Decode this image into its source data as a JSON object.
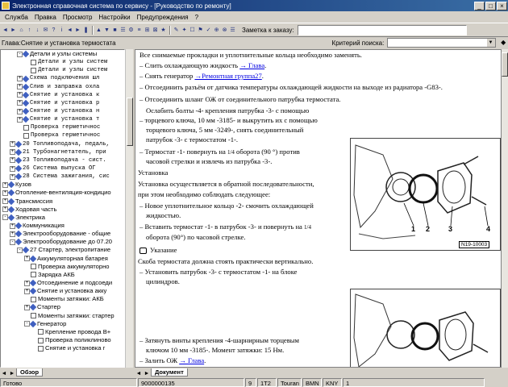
{
  "window": {
    "title": "Электронная справочная система по сервису - [Руководство по ремонту]",
    "min": "_",
    "max": "□",
    "close": "×"
  },
  "menu": [
    "Служба",
    "Правка",
    "Просмотр",
    "Настройки",
    "Предупреждения",
    "?"
  ],
  "toolbar": {
    "buttons": [
      "◄",
      "►",
      "⌂",
      "↑",
      "↓",
      "✉",
      "?",
      "i",
      "◄",
      "►",
      "❚",
      "▲",
      "▼",
      "■",
      "☰",
      "⚙",
      "≡",
      "⊞",
      "⊠",
      "★",
      "✎",
      "✦",
      "☐",
      "⚑",
      "✓",
      "⊕",
      "⊗",
      "☰"
    ],
    "note_label": "Заметка к заказу:"
  },
  "address": {
    "chapter_label": "Глава:Снятие и установка термостата",
    "search_label": "Критерий поиска:",
    "search_dropdown": "▼",
    "search_button": "◆"
  },
  "tree": [
    {
      "indent": 2,
      "pm": "-",
      "icon": "book",
      "text": "Детали и узлы системы",
      "mono": false
    },
    {
      "indent": 3,
      "pm": "",
      "icon": "page",
      "text": "Детали и узлы систем",
      "mono": true
    },
    {
      "indent": 3,
      "pm": "",
      "icon": "page",
      "text": "Детали и узлы систем",
      "mono": true
    },
    {
      "indent": 2,
      "pm": "+",
      "icon": "book",
      "text": "Схема подключения шл",
      "mono": true
    },
    {
      "indent": 2,
      "pm": "+",
      "icon": "book",
      "text": "Слив и заправка охла",
      "mono": true
    },
    {
      "indent": 2,
      "pm": "+",
      "icon": "book",
      "text": "Снятие и установка к",
      "mono": true
    },
    {
      "indent": 2,
      "pm": "+",
      "icon": "book",
      "text": "Снятие и установка р",
      "mono": true
    },
    {
      "indent": 2,
      "pm": "+",
      "icon": "book",
      "text": "Снятие и установка н",
      "mono": true
    },
    {
      "indent": 2,
      "pm": "+",
      "icon": "book",
      "text": "Снятие и установка т",
      "mono": true
    },
    {
      "indent": 2,
      "pm": "",
      "icon": "page",
      "text": "Проверка герметичнос",
      "mono": true
    },
    {
      "indent": 2,
      "pm": "",
      "icon": "page",
      "text": "Проверка герметичнос",
      "mono": true
    },
    {
      "indent": 1,
      "pm": "+",
      "icon": "book",
      "text": "20 Топливоподача, педаль,",
      "mono": true
    },
    {
      "indent": 1,
      "pm": "+",
      "icon": "book",
      "text": "21 Турбонагнетатель, при",
      "mono": true
    },
    {
      "indent": 1,
      "pm": "+",
      "icon": "book",
      "text": "23 Топливоподача - сист.",
      "mono": true
    },
    {
      "indent": 1,
      "pm": "+",
      "icon": "book",
      "text": "26 Система выпуска ОГ",
      "mono": true
    },
    {
      "indent": 1,
      "pm": "+",
      "icon": "book",
      "text": "28 Система зажигания, сис",
      "mono": true
    },
    {
      "indent": 0,
      "pm": "+",
      "icon": "book",
      "text": "Кузов",
      "mono": false
    },
    {
      "indent": 0,
      "pm": "+",
      "icon": "book",
      "text": "Отопление-вентиляция-кондицио",
      "mono": false
    },
    {
      "indent": 0,
      "pm": "+",
      "icon": "book",
      "text": "Трансмиссия",
      "mono": false
    },
    {
      "indent": 0,
      "pm": "+",
      "icon": "book",
      "text": "Ходовая часть",
      "mono": false
    },
    {
      "indent": 0,
      "pm": "-",
      "icon": "book",
      "text": "Электрика",
      "mono": false
    },
    {
      "indent": 1,
      "pm": "+",
      "icon": "book",
      "text": "Коммуникация",
      "mono": false
    },
    {
      "indent": 1,
      "pm": "+",
      "icon": "book",
      "text": "Электрооборудование - общие",
      "mono": false
    },
    {
      "indent": 1,
      "pm": "-",
      "icon": "book",
      "text": "Электрооборудование до 07.20",
      "mono": false
    },
    {
      "indent": 2,
      "pm": "-",
      "icon": "book",
      "text": "27 Стартер, электропитание",
      "mono": false
    },
    {
      "indent": 3,
      "pm": "+",
      "icon": "book",
      "text": "Аккумуляторная батарея",
      "mono": false
    },
    {
      "indent": 3,
      "pm": "",
      "icon": "page",
      "text": "Проверка аккумуляторно",
      "mono": false
    },
    {
      "indent": 3,
      "pm": "",
      "icon": "page",
      "text": "Зарядка АКБ",
      "mono": false
    },
    {
      "indent": 3,
      "pm": "+",
      "icon": "book",
      "text": "Отсоединение и подсоеди",
      "mono": false
    },
    {
      "indent": 3,
      "pm": "+",
      "icon": "book",
      "text": "Снятие и установка акку",
      "mono": false
    },
    {
      "indent": 3,
      "pm": "",
      "icon": "page",
      "text": "Моменты затяжки: АКБ",
      "mono": false
    },
    {
      "indent": 3,
      "pm": "+",
      "icon": "book",
      "text": "Стартер",
      "mono": false
    },
    {
      "indent": 3,
      "pm": "",
      "icon": "page",
      "text": "Моменты затяжки: стартер",
      "mono": false
    },
    {
      "indent": 3,
      "pm": "-",
      "icon": "book",
      "text": "Генератор",
      "mono": false
    },
    {
      "indent": 4,
      "pm": "",
      "icon": "page",
      "text": "Крепление провода В+",
      "mono": false
    },
    {
      "indent": 4,
      "pm": "",
      "icon": "page",
      "text": "Проверка поликлиново",
      "mono": false
    },
    {
      "indent": 4,
      "pm": "",
      "icon": "page",
      "text": "Снятие и установка г",
      "mono": false
    }
  ],
  "doc": {
    "l1": "Все снимаемые прокладки и уплотнительные кольца необходимо заменять.",
    "l2a": "– Слить охлаждающую жидкость ",
    "l2link": "→ Глава",
    "l2b": ".",
    "l3a": "– Снять генератор ",
    "l3link": "→Ремонтная группа27",
    "l3b": ".",
    "l4": "– Отсоединить разъём от датчика температуры охлаждающей жидкости на выходе из радиатора -G83-.",
    "l5": "– Отсоединить шланг ОЖ от соединительного патрубка термостата.",
    "l6": "Ослабить болты -4- крепления патрубка -3- с помощью",
    "l7": "торцевого ключа, 10 мм -3185- и выкрутить их с помощью",
    "l8": "торцевого ключа, 5 мм -3249-, снять соединительный",
    "l9": "патрубок -3- с термостатом -1-.",
    "l10a": "– Термостат -1- повернуть на ",
    "l10frac": "1/4",
    "l10b": " оборота (90 °) против",
    "l11": "часовой стрелки и извлечь из патрубка -3-.",
    "l12": "Установка",
    "l13": "Установка осуществляется в обратной последовательности,",
    "l14": "при этом необходимо соблюдать следующее:",
    "l15": "– Новое уплотнительное кольцо -2- смочить охлаждающей",
    "l16": "жидкостью.",
    "l17a": "– Вставить термостат -1- в патрубок -3- и повернуть на ",
    "l17frac": "1/4",
    "l18": "оборота (90°) по часовой стрелке.",
    "l19": "Указание",
    "l20": "Скоба термостата должна стоять практически вертикально.",
    "l21": "– Установить патрубок -3- с термостатом -1- на блоке",
    "l22": "цилиндров.",
    "l23": "– Затянуть винты крепления -4-шарнирным торцевым",
    "l24": "ключом 10 мм -3185-. Момент затяжки: 15 Нм.",
    "l25a": "– Залить ОЖ ",
    "l25link": "→ Глава",
    "l25b": ".",
    "fig1_labels": [
      "1",
      "2",
      "3",
      "4"
    ],
    "fig1_code": "N19-10003"
  },
  "tabs": {
    "left": "Обзор",
    "right": "Документ"
  },
  "status": [
    "Готово",
    "9000000135",
    "9",
    "1T2",
    "Touran",
    "BMN",
    "KNY",
    "1"
  ]
}
